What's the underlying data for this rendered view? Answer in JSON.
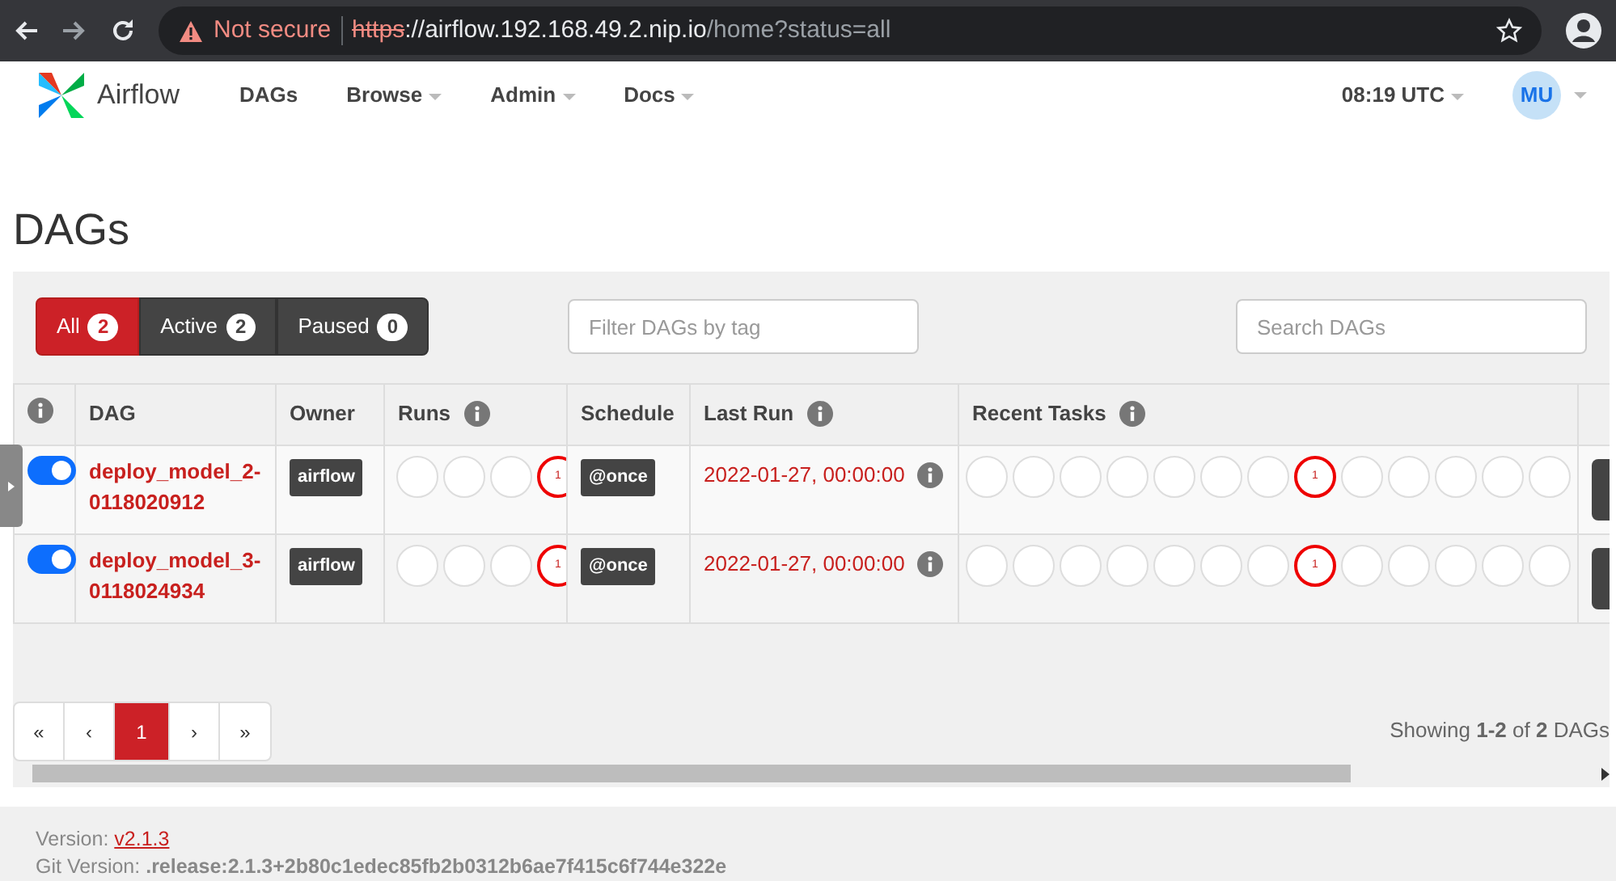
{
  "browser": {
    "security": "Not secure",
    "url_scheme": "https",
    "url_host": "://airflow.192.168.49.2.nip.io",
    "url_path": "/home?status=all"
  },
  "navbar": {
    "brand": "Airflow",
    "menu": [
      {
        "label": "DAGs",
        "dropdown": false
      },
      {
        "label": "Browse",
        "dropdown": true
      },
      {
        "label": "Admin",
        "dropdown": true
      },
      {
        "label": "Docs",
        "dropdown": true
      }
    ],
    "clock": "08:19 UTC",
    "user": "MU"
  },
  "page_title": "DAGs",
  "status_tabs": [
    {
      "label": "All",
      "count": "2",
      "selected": true
    },
    {
      "label": "Active",
      "count": "2",
      "selected": false
    },
    {
      "label": "Paused",
      "count": "0",
      "selected": false
    }
  ],
  "tag_filter": {
    "placeholder": "Filter DAGs by tag"
  },
  "search": {
    "placeholder": "Search DAGs"
  },
  "table": {
    "columns": [
      {
        "info": true
      },
      {
        "label": "DAG",
        "info": false
      },
      {
        "label": "Owner",
        "info": false
      },
      {
        "label": "Runs",
        "info": true
      },
      {
        "label": "Schedule",
        "info": false
      },
      {
        "label": "Last Run",
        "info": true
      },
      {
        "label": "Recent Tasks",
        "info": true
      }
    ],
    "rows": [
      {
        "active": true,
        "dag_id": "deploy_model_2-0118020912",
        "owner": "airflow",
        "runs": [
          {
            "kind": "empty"
          },
          {
            "kind": "empty"
          },
          {
            "kind": "empty"
          },
          {
            "kind": "failed",
            "count": "1"
          }
        ],
        "schedule": "@once",
        "last_run": "2022-01-27, 00:00:00",
        "recent_tasks": [
          {
            "kind": "empty"
          },
          {
            "kind": "empty"
          },
          {
            "kind": "empty"
          },
          {
            "kind": "empty"
          },
          {
            "kind": "empty"
          },
          {
            "kind": "empty"
          },
          {
            "kind": "empty"
          },
          {
            "kind": "failed",
            "count": "1"
          },
          {
            "kind": "empty"
          },
          {
            "kind": "empty"
          },
          {
            "kind": "empty"
          },
          {
            "kind": "empty"
          },
          {
            "kind": "empty"
          }
        ]
      },
      {
        "active": true,
        "dag_id": "deploy_model_3-0118024934",
        "owner": "airflow",
        "runs": [
          {
            "kind": "empty"
          },
          {
            "kind": "empty"
          },
          {
            "kind": "empty"
          },
          {
            "kind": "failed",
            "count": "1"
          }
        ],
        "schedule": "@once",
        "last_run": "2022-01-27, 00:00:00",
        "recent_tasks": [
          {
            "kind": "empty"
          },
          {
            "kind": "empty"
          },
          {
            "kind": "empty"
          },
          {
            "kind": "empty"
          },
          {
            "kind": "empty"
          },
          {
            "kind": "empty"
          },
          {
            "kind": "empty"
          },
          {
            "kind": "failed",
            "count": "1"
          },
          {
            "kind": "empty"
          },
          {
            "kind": "empty"
          },
          {
            "kind": "empty"
          },
          {
            "kind": "empty"
          },
          {
            "kind": "empty"
          }
        ]
      }
    ]
  },
  "pagination": {
    "pages": [
      {
        "label": "«",
        "selected": false
      },
      {
        "label": "‹",
        "selected": false
      },
      {
        "label": "1",
        "selected": true
      },
      {
        "label": "›",
        "selected": false
      },
      {
        "label": "»",
        "selected": false
      }
    ],
    "summary": "Showing **1-2** of **2** DAGs"
  },
  "footer": {
    "version_label": "Version:",
    "version": "v2.1.3",
    "git": "Git Version: **.release:2.1.3+2b80c1edec85fb2b0312b6ae7f415c6f744e322e**"
  }
}
